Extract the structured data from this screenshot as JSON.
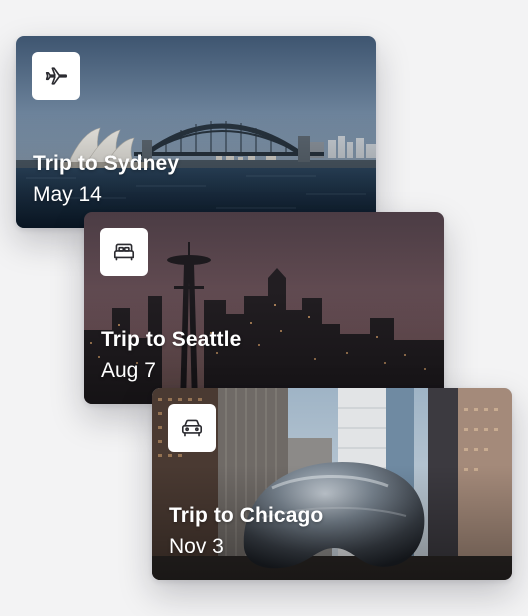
{
  "trips": [
    {
      "title": "Trip to Sydney",
      "date": "May 14",
      "icon": "plane-icon"
    },
    {
      "title": "Trip to Seattle",
      "date": "Aug 7",
      "icon": "bed-icon"
    },
    {
      "title": "Trip to Chicago",
      "date": "Nov 3",
      "icon": "car-icon"
    }
  ],
  "colors": {
    "page_background": "#f3f3f4",
    "badge_background": "#ffffff",
    "icon_stroke": "#2b2b30",
    "text": "#ffffff"
  }
}
